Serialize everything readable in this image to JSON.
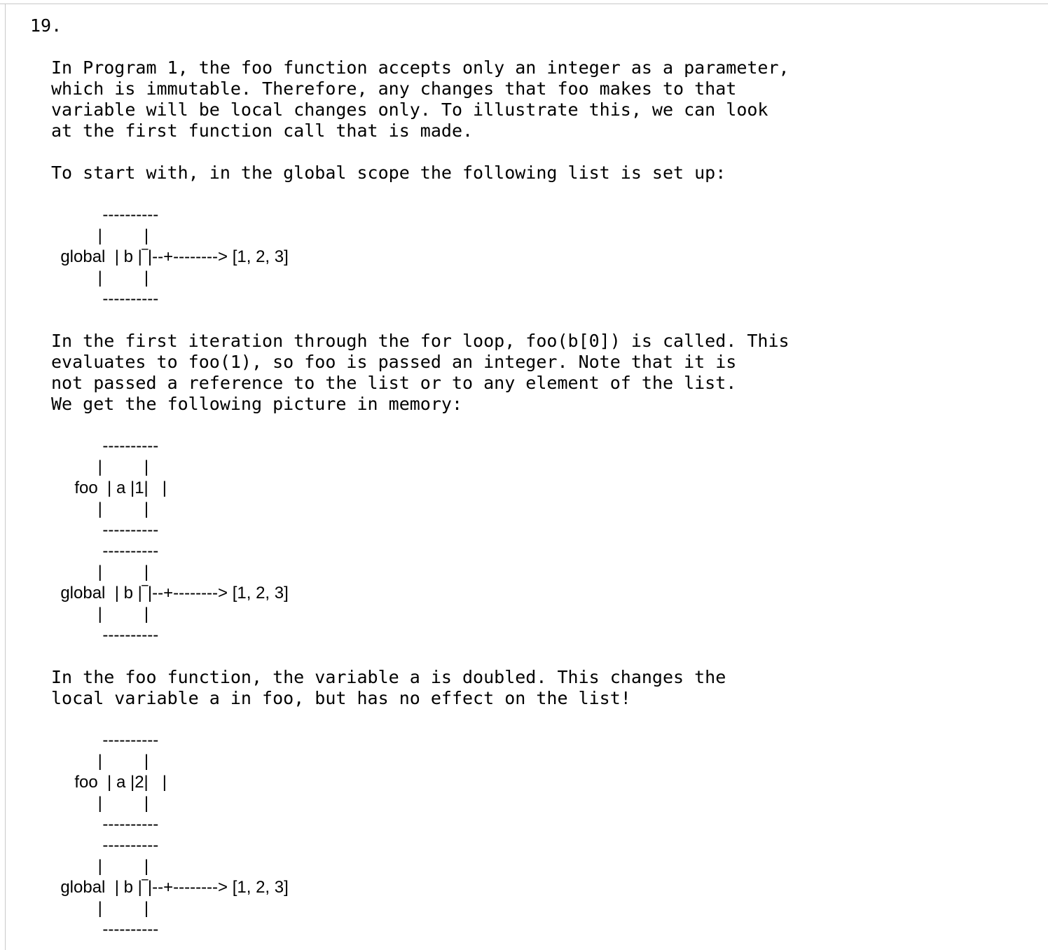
{
  "question_number": "19.",
  "paragraphs": [
    "In Program 1, the foo function accepts only an integer as a parameter,\nwhich is immutable. Therefore, any changes that foo makes to that\nvariable will be local changes only. To illustrate this, we can look\nat the first function call that is made.",
    "To start with, in the global scope the following list is set up:",
    "In the first iteration through the for loop, foo(b[0]) is called. This\nevaluates to foo(1), so foo is passed an integer. Note that it is\nnot passed a reference to the list or to any element of the list.\nWe get the following picture in memory:",
    "In the foo function, the variable a is doubled. This changes the\nlocal variable a in foo, but has no effect on the list!"
  ],
  "diagrams": [
    "           ----------\n          |         |\n  global  | b |‾|--+--------> [1, 2, 3]\n          |         |\n           ----------",
    "           ----------\n          |         |\n     foo  | a |1|   |\n          |         |\n           ----------\n           ----------\n          |         |\n  global  | b |‾|--+--------> [1, 2, 3]\n          |         |\n           ----------",
    "           ----------\n          |         |\n     foo  | a |2|   |\n          |         |\n           ----------\n           ----------\n          |         |\n  global  | b |‾|--+--------> [1, 2, 3]\n          |         |\n           ----------"
  ]
}
